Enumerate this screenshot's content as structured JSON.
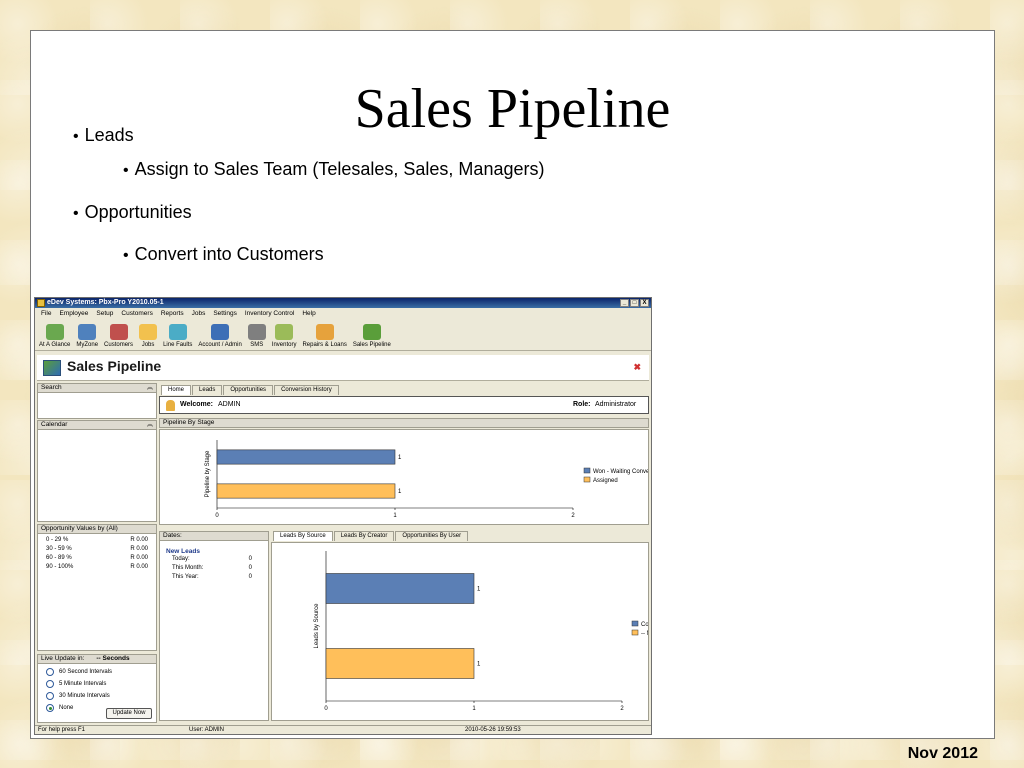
{
  "slide": {
    "title": "Sales Pipeline",
    "bullets": [
      {
        "level": 1,
        "text": "Leads"
      },
      {
        "level": 2,
        "text": "Assign to Sales Team (Telesales, Sales, Managers)"
      },
      {
        "level": 1,
        "text": "Opportunities"
      },
      {
        "level": 2,
        "text": "Convert into Customers"
      }
    ],
    "footer_date": "Nov 2012"
  },
  "app": {
    "window_title": "eDev Systems: Pbx-Pro Y2010.05-1",
    "window_buttons": [
      "_",
      "□",
      "X"
    ],
    "menu": [
      "File",
      "Employee",
      "Setup",
      "Customers",
      "Reports",
      "Jobs",
      "Settings",
      "Inventory Control",
      "Help"
    ],
    "toolbar": [
      {
        "label": "At A Glance",
        "icon": "glance-icon",
        "color": "#6aa84f"
      },
      {
        "label": "MyZone",
        "icon": "home-icon",
        "color": "#4f81bd"
      },
      {
        "label": "Customers",
        "icon": "customers-icon",
        "color": "#c0504d"
      },
      {
        "label": "Jobs",
        "icon": "jobs-icon",
        "color": "#f2c14e"
      },
      {
        "label": "Line Faults",
        "icon": "line-faults-icon",
        "color": "#4bacc6"
      },
      {
        "label": "Account / Admin",
        "icon": "account-icon",
        "color": "#3d6fb6"
      },
      {
        "label": "SMS",
        "icon": "sms-icon",
        "color": "#7f7f7f"
      },
      {
        "label": "Inventory",
        "icon": "inventory-icon",
        "color": "#9bbb59"
      },
      {
        "label": "Repairs & Loans",
        "icon": "repairs-icon",
        "color": "#e6a23c"
      },
      {
        "label": "Sales Pipeline",
        "icon": "sales-pipeline-icon",
        "color": "#5a9e3a"
      }
    ],
    "page_title": "Sales Pipeline",
    "left": {
      "search_label": "Search",
      "calendar_label": "Calendar",
      "opp_values_label": "Opportunity Values by (All)",
      "opp_values": [
        {
          "range": "0 - 29 %",
          "value": "R 0.00"
        },
        {
          "range": "30 - 59 %",
          "value": "R 0.00"
        },
        {
          "range": "60 - 89 %",
          "value": "R 0.00"
        },
        {
          "range": "90 - 100%",
          "value": "R 0.00"
        }
      ],
      "live_update_label": "Live Update in:",
      "live_update_value": "-- Seconds",
      "intervals": [
        {
          "label": "60 Second Intervals",
          "selected": false
        },
        {
          "label": "5 Minute Intervals",
          "selected": false
        },
        {
          "label": "30 Minute Intervals",
          "selected": false
        },
        {
          "label": "None",
          "selected": true
        }
      ],
      "update_button": "Update Now"
    },
    "main_tabs": [
      "Home",
      "Leads",
      "Opportunities",
      "Conversion History"
    ],
    "welcome_label": "Welcome:",
    "welcome_user": "ADMIN",
    "role_label": "Role:",
    "role_value": "Administrator",
    "pipeline_header": "Pipeline By Stage",
    "dates": {
      "header": "Dates:",
      "title": "New Leads",
      "rows": [
        {
          "label": "Today:",
          "value": "0"
        },
        {
          "label": "This Month:",
          "value": "0"
        },
        {
          "label": "This Year:",
          "value": "0"
        }
      ]
    },
    "lower_tabs": [
      "Leads By Source",
      "Leads By Creator",
      "Opportunities By User"
    ],
    "status": {
      "help": "For help press F1",
      "user": "User: ADMIN",
      "datetime": "2010-05-26 19:59:53"
    }
  },
  "chart_data": [
    {
      "type": "bar",
      "orientation": "horizontal",
      "ylabel": "Pipeline by Stage",
      "categories": [
        "Won - Waiting Conversion",
        "Assigned"
      ],
      "series": [
        {
          "name": "Won - Waiting Conversion",
          "values": [
            1,
            0
          ],
          "color": "#5b7fb5"
        },
        {
          "name": "Assigned",
          "values": [
            0,
            1
          ],
          "color": "#ffbf5a"
        }
      ],
      "xlim": [
        0,
        2
      ],
      "xticks": [
        "0",
        "1",
        "2"
      ],
      "legend": "right"
    },
    {
      "type": "bar",
      "orientation": "horizontal",
      "ylabel": "Leads by Source",
      "categories": [
        "Cold Call",
        "-- None --"
      ],
      "series": [
        {
          "name": "Cold Call",
          "values": [
            1,
            0
          ],
          "color": "#5b7fb5"
        },
        {
          "name": "-- None --",
          "values": [
            0,
            1
          ],
          "color": "#ffbf5a"
        }
      ],
      "xlim": [
        0,
        2
      ],
      "xticks": [
        "0",
        "1",
        "2"
      ],
      "legend": "right"
    }
  ]
}
